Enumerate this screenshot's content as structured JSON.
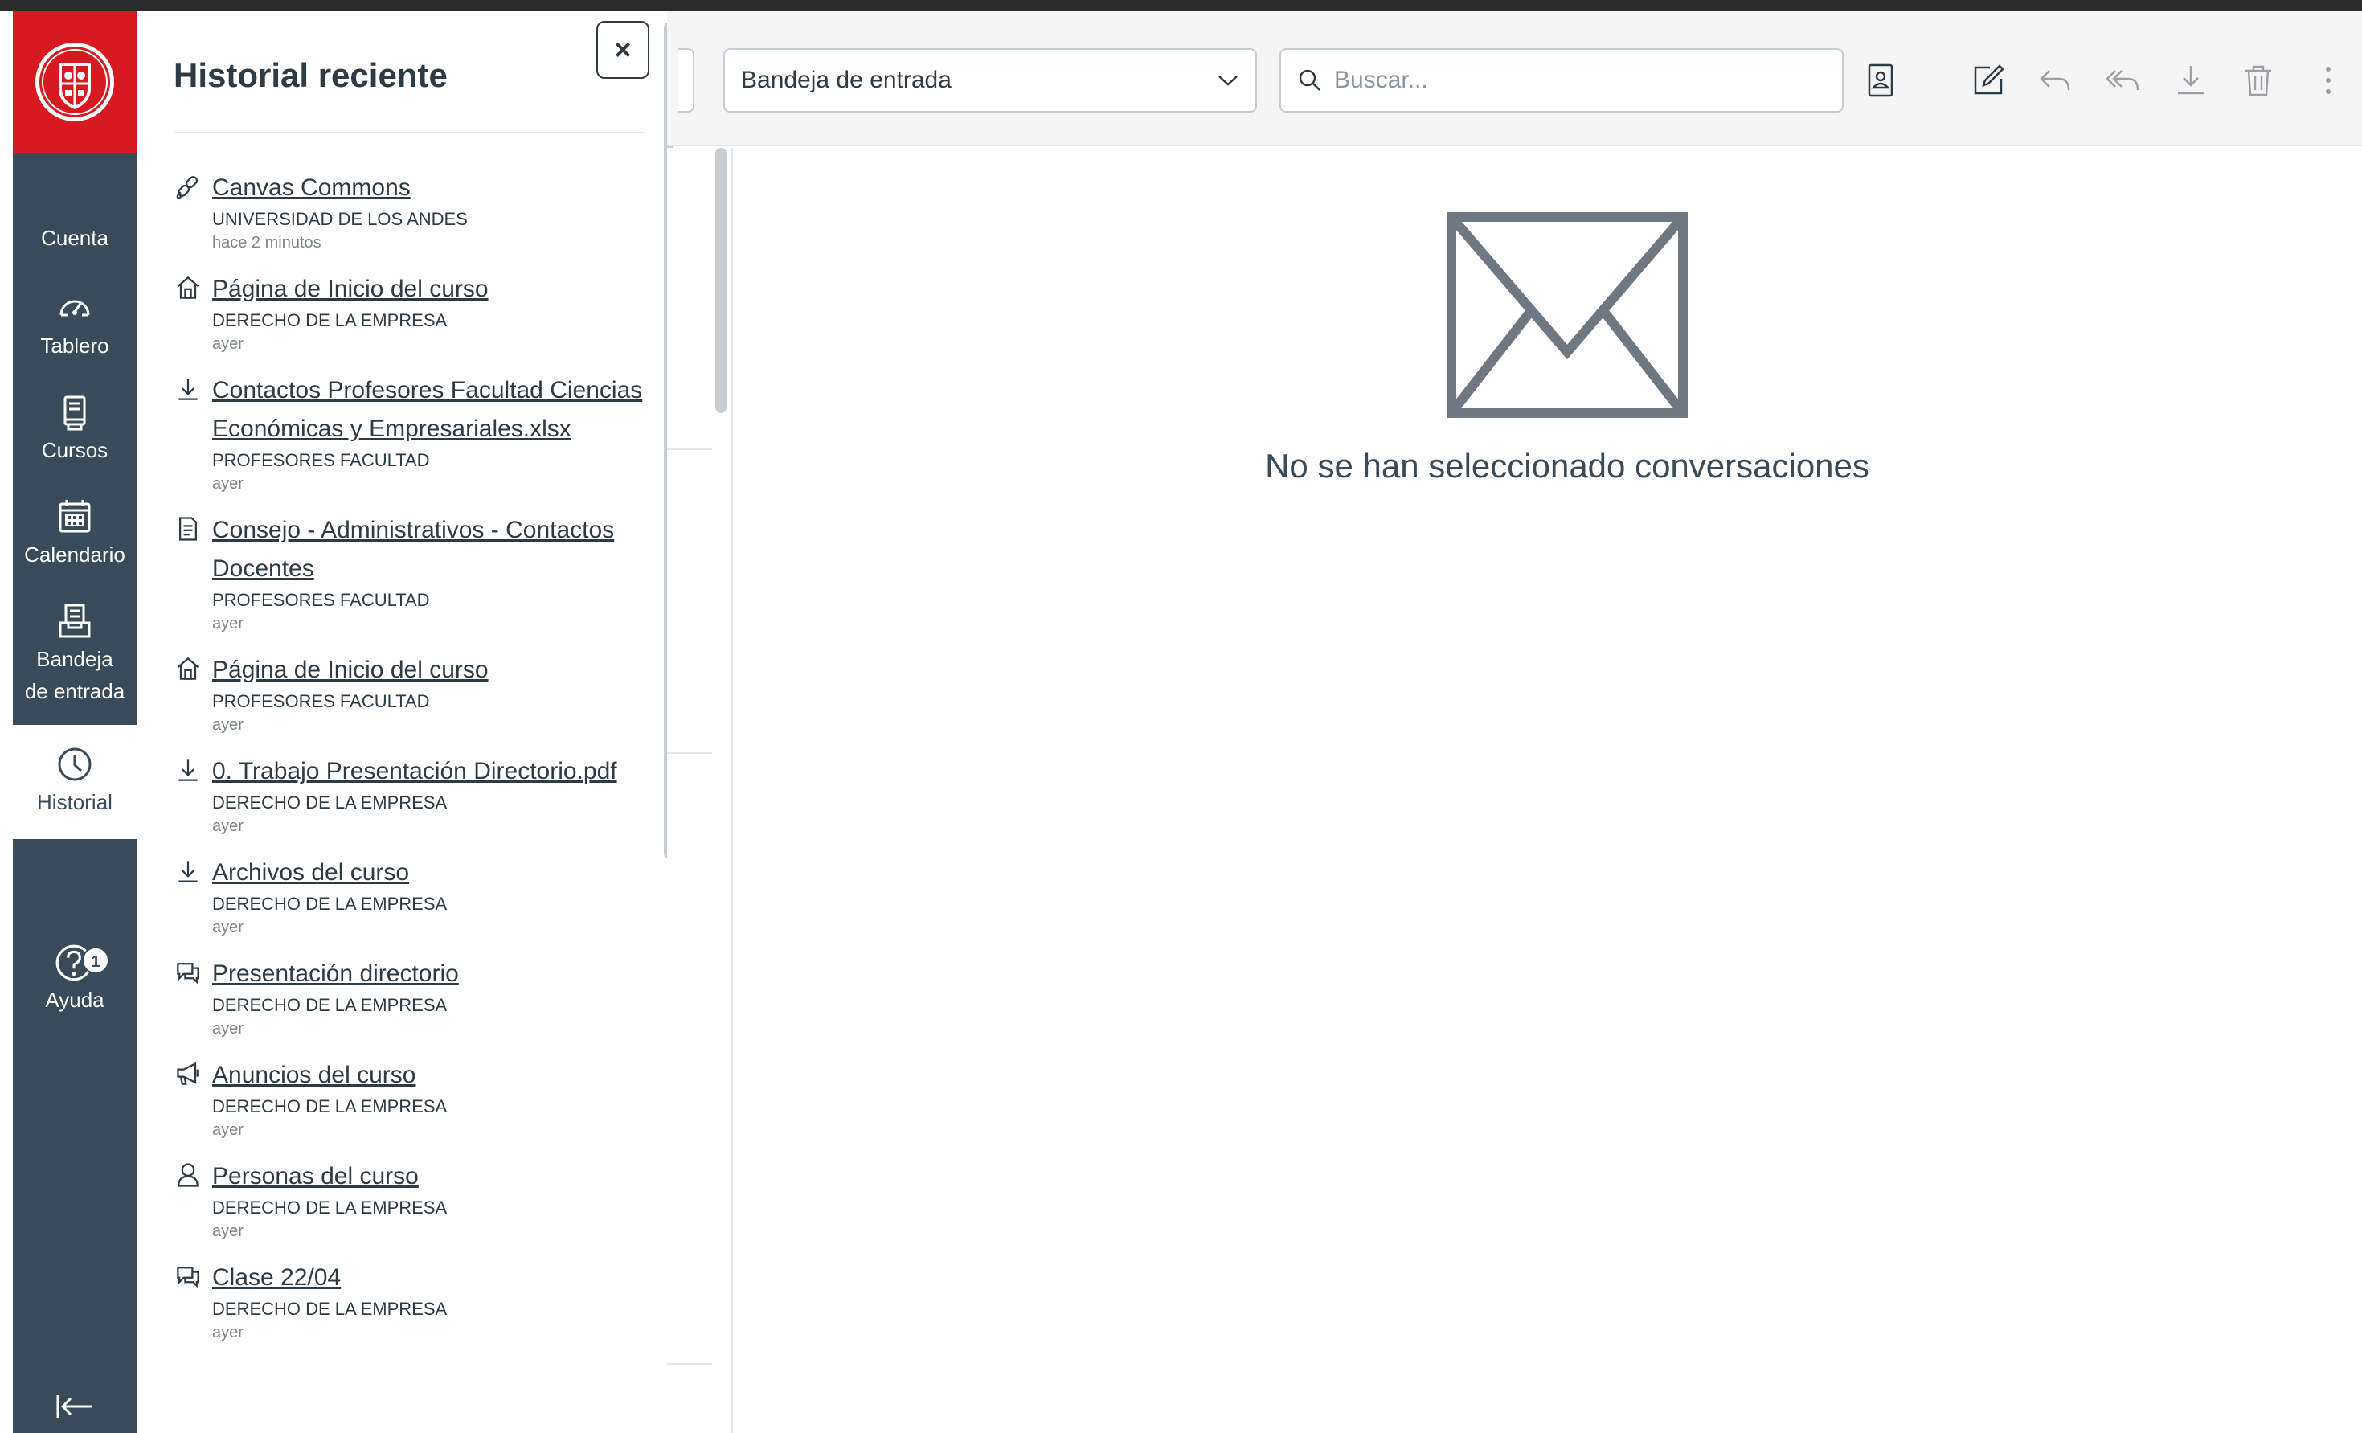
{
  "global_nav": {
    "items": [
      {
        "label": "Cuenta",
        "icon": "account-icon"
      },
      {
        "label": "Tablero",
        "icon": "dashboard-icon"
      },
      {
        "label": "Cursos",
        "icon": "courses-icon"
      },
      {
        "label": "Calendario",
        "icon": "calendar-icon"
      },
      {
        "label": "Bandeja de entrada",
        "icon": "inbox-icon"
      },
      {
        "label": "Historial",
        "icon": "history-icon",
        "active": true
      },
      {
        "label": "Ayuda",
        "icon": "help-icon",
        "badge": "1"
      }
    ],
    "collapse_icon": "collapse-nav-icon",
    "brand_color": "#d71920",
    "nav_color": "#394b58"
  },
  "history_tray": {
    "title": "Historial reciente",
    "close_label": "×",
    "items": [
      {
        "title": "Canvas Commons",
        "course": "UNIVERSIDAD DE LOS ANDES",
        "time": "hace 2 minutos",
        "icon": "link-icon"
      },
      {
        "title": "Página de Inicio del curso",
        "course": "DERECHO DE LA EMPRESA",
        "time": "ayer",
        "icon": "home-icon"
      },
      {
        "title": "Contactos Profesores Facultad Ciencias Económicas y Empresariales.xlsx",
        "course": "PROFESORES FACULTAD",
        "time": "ayer",
        "icon": "download-icon"
      },
      {
        "title": "Consejo - Administrativos - Contactos Docentes",
        "course": "PROFESORES FACULTAD",
        "time": "ayer",
        "icon": "document-icon"
      },
      {
        "title": "Página de Inicio del curso",
        "course": "PROFESORES FACULTAD",
        "time": "ayer",
        "icon": "home-icon"
      },
      {
        "title": "0. Trabajo Presentación Directorio.pdf",
        "course": "DERECHO DE LA EMPRESA",
        "time": "ayer",
        "icon": "download-icon"
      },
      {
        "title": "Archivos del curso",
        "course": "DERECHO DE LA EMPRESA",
        "time": "ayer",
        "icon": "download-icon"
      },
      {
        "title": "Presentación directorio",
        "course": "DERECHO DE LA EMPRESA",
        "time": "ayer",
        "icon": "discussion-icon"
      },
      {
        "title": "Anuncios del curso",
        "course": "DERECHO DE LA EMPRESA",
        "time": "ayer",
        "icon": "announcement-icon"
      },
      {
        "title": "Personas del curso",
        "course": "DERECHO DE LA EMPRESA",
        "time": "ayer",
        "icon": "user-icon"
      },
      {
        "title": "Clase 22/04",
        "course": "DERECHO DE LA EMPRESA",
        "time": "ayer",
        "icon": "discussion-icon"
      }
    ]
  },
  "toolbar": {
    "mailbox_value": "Bandeja de entrada",
    "search_placeholder": "Buscar...",
    "buttons": [
      "address-book-icon",
      "compose-icon",
      "reply-icon",
      "reply-all-icon",
      "archive-icon",
      "delete-icon",
      "more-icon"
    ]
  },
  "main": {
    "empty_message": "No se han seleccionado conversaciones"
  }
}
